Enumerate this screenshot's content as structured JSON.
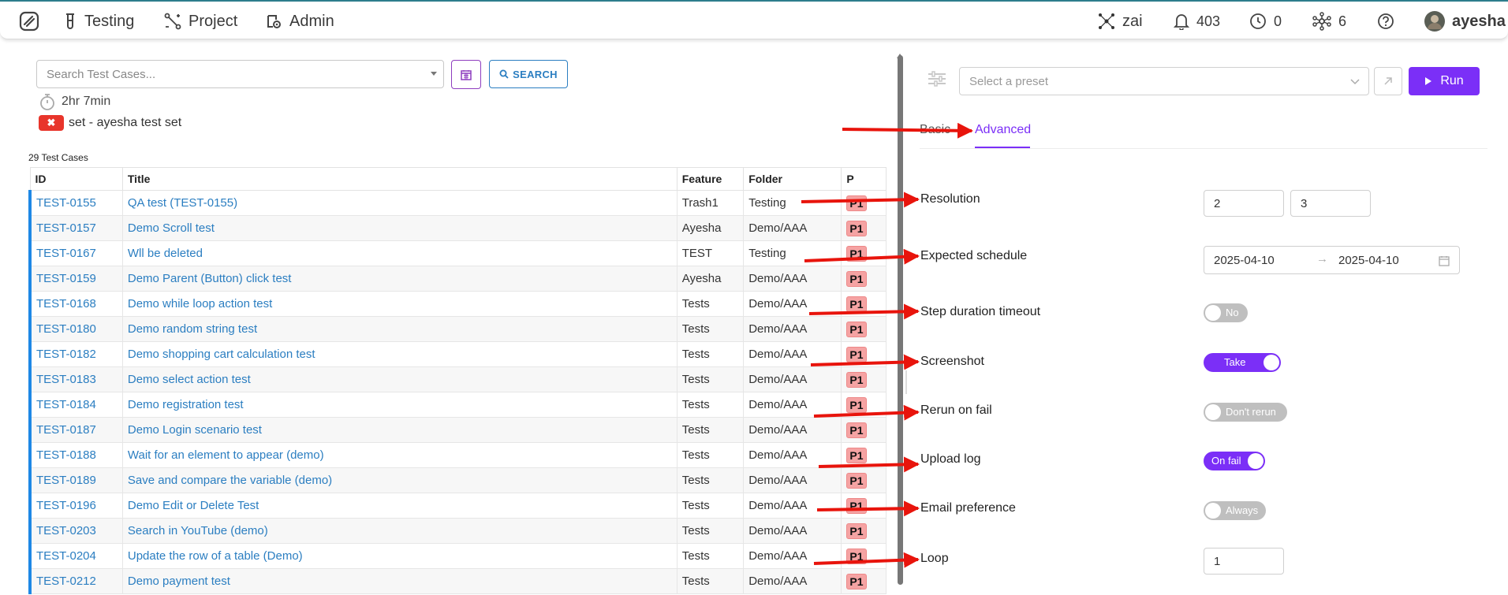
{
  "nav": {
    "items": [
      {
        "label": "Testing",
        "icon": "test-tube-icon"
      },
      {
        "label": "Project",
        "icon": "project-nodes-icon"
      },
      {
        "label": "Admin",
        "icon": "admin-settings-icon"
      }
    ],
    "zai_label": "zai",
    "notifications_count": "403",
    "clock_count": "0",
    "network_count": "6",
    "username": "ayesha"
  },
  "left": {
    "search_placeholder": "Search Test Cases...",
    "search_button": "SEARCH",
    "duration": "2hr 7min",
    "set_label": "set - ayesha test set",
    "count_label": "29 Test Cases",
    "columns": [
      "ID",
      "Title",
      "Feature",
      "Folder",
      "P"
    ],
    "rows": [
      {
        "id": "TEST-0155",
        "title": "QA test (TEST-0155)",
        "feature": "Trash1",
        "folder": "Testing",
        "p": "P1"
      },
      {
        "id": "TEST-0157",
        "title": "Demo Scroll test",
        "feature": "Ayesha",
        "folder": "Demo/AAA",
        "p": "P1"
      },
      {
        "id": "TEST-0167",
        "title": "Wll be deleted",
        "feature": "TEST",
        "folder": "Testing",
        "p": "P1"
      },
      {
        "id": "TEST-0159",
        "title": "Demo Parent (Button) click test",
        "feature": "Ayesha",
        "folder": "Demo/AAA",
        "p": "P1"
      },
      {
        "id": "TEST-0168",
        "title": "Demo while loop action test",
        "feature": "Tests",
        "folder": "Demo/AAA",
        "p": "P1"
      },
      {
        "id": "TEST-0180",
        "title": "Demo random string test",
        "feature": "Tests",
        "folder": "Demo/AAA",
        "p": "P1"
      },
      {
        "id": "TEST-0182",
        "title": "Demo shopping cart calculation test",
        "feature": "Tests",
        "folder": "Demo/AAA",
        "p": "P1"
      },
      {
        "id": "TEST-0183",
        "title": "Demo select action test",
        "feature": "Tests",
        "folder": "Demo/AAA",
        "p": "P1"
      },
      {
        "id": "TEST-0184",
        "title": "Demo registration test",
        "feature": "Tests",
        "folder": "Demo/AAA",
        "p": "P1"
      },
      {
        "id": "TEST-0187",
        "title": "Demo Login scenario test",
        "feature": "Tests",
        "folder": "Demo/AAA",
        "p": "P1"
      },
      {
        "id": "TEST-0188",
        "title": "Wait for an element to appear (demo)",
        "feature": "Tests",
        "folder": "Demo/AAA",
        "p": "P1"
      },
      {
        "id": "TEST-0189",
        "title": "Save and compare the variable (demo)",
        "feature": "Tests",
        "folder": "Demo/AAA",
        "p": "P1"
      },
      {
        "id": "TEST-0196",
        "title": "Demo Edit or Delete Test",
        "feature": "Tests",
        "folder": "Demo/AAA",
        "p": "P1"
      },
      {
        "id": "TEST-0203",
        "title": "Search in YouTube (demo)",
        "feature": "Tests",
        "folder": "Demo/AAA",
        "p": "P1"
      },
      {
        "id": "TEST-0204",
        "title": "Update the row of a table (Demo)",
        "feature": "Tests",
        "folder": "Demo/AAA",
        "p": "P1"
      },
      {
        "id": "TEST-0212",
        "title": "Demo payment test",
        "feature": "Tests",
        "folder": "Demo/AAA",
        "p": "P1"
      }
    ]
  },
  "right": {
    "preset_placeholder": "Select a preset",
    "run_label": "Run",
    "tabs": {
      "basic": "Basic",
      "advanced": "Advanced"
    },
    "resolution": {
      "label": "Resolution",
      "width": "2",
      "height": "3"
    },
    "schedule": {
      "label": "Expected schedule",
      "start": "2025-04-10",
      "end": "2025-04-10"
    },
    "step_timeout": {
      "label": "Step duration timeout",
      "value": "No"
    },
    "screenshot": {
      "label": "Screenshot",
      "value": "Take"
    },
    "rerun": {
      "label": "Rerun on fail",
      "value": "Don't rerun"
    },
    "upload_log": {
      "label": "Upload log",
      "value": "On fail"
    },
    "email": {
      "label": "Email preference",
      "value": "Always"
    },
    "loop": {
      "label": "Loop",
      "value": "1"
    }
  },
  "colors": {
    "accent": "#7b2ff7",
    "link": "#2b7ec1",
    "arrow": "#e8140c",
    "priority": "#f5a3a3"
  }
}
